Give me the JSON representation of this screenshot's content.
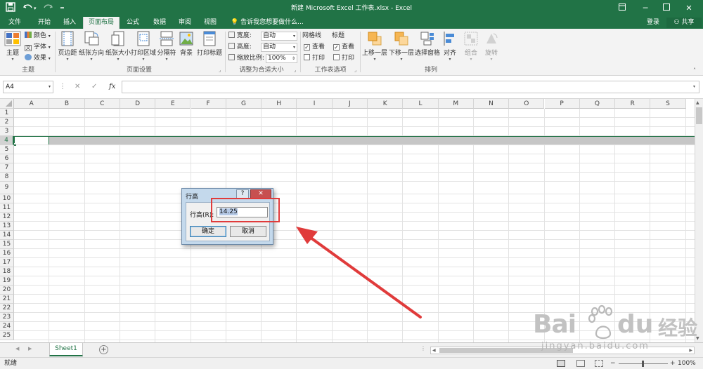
{
  "window": {
    "title": "新建 Microsoft Excel 工作表.xlsx - Excel",
    "qa_save_icon": "save-icon",
    "qa_undo_icon": "undo-icon",
    "qa_redo_icon": "redo-icon",
    "controls": [
      "?",
      "─",
      "□",
      "✕"
    ]
  },
  "tabs": [
    "文件",
    "开始",
    "插入",
    "页面布局",
    "公式",
    "数据",
    "审阅",
    "视图"
  ],
  "active_tab": "页面布局",
  "tell_me": "告诉我您想要做什么...",
  "login": "登录",
  "share": "共享",
  "ribbon": {
    "theme": {
      "main_label": "主题",
      "colors": "颜色",
      "fonts": "字体",
      "effects": "效果",
      "group": "主题"
    },
    "page_setup": {
      "buttons": [
        "页边距",
        "纸张方向",
        "纸张大小",
        "打印区域",
        "分隔符",
        "背景",
        "打印标题"
      ],
      "group": "页面设置"
    },
    "scale": {
      "width_label": "宽度:",
      "width_value": "自动",
      "height_label": "高度:",
      "height_value": "自动",
      "scale_label": "缩放比例:",
      "scale_value": "100%",
      "group": "调整为合适大小"
    },
    "sheet_options": {
      "gridlines": "网格线",
      "headings": "标题",
      "view": "查看",
      "print": "打印",
      "group": "工作表选项"
    },
    "arrange": {
      "buttons": [
        "上移一层",
        "下移一层",
        "选择窗格",
        "对齐",
        "组合",
        "旋转"
      ],
      "group": "排列"
    }
  },
  "formula_bar": {
    "name_box": "A4",
    "cancel": "✕",
    "enter": "✓",
    "fx": "fx"
  },
  "grid": {
    "columns": [
      "A",
      "B",
      "C",
      "D",
      "E",
      "F",
      "G",
      "H",
      "I",
      "J",
      "K",
      "L",
      "M",
      "N",
      "O",
      "P",
      "Q",
      "R",
      "S"
    ],
    "rows": [
      "1",
      "2",
      "3",
      "4",
      "5",
      "6",
      "7",
      "8",
      "9",
      "10",
      "11",
      "12",
      "13",
      "14",
      "15",
      "16",
      "17",
      "18",
      "19",
      "20",
      "21",
      "22",
      "23",
      "24",
      "25"
    ],
    "selected_row": "4"
  },
  "sheet_tab": "Sheet1",
  "add_sheet": "+",
  "status": {
    "ready": "就绪",
    "zoom": "100%"
  },
  "dialog": {
    "title": "行高",
    "help": "?",
    "close": "✕",
    "label": "行高(R):",
    "value": "14.25",
    "ok": "确定",
    "cancel": "取消"
  },
  "watermark": {
    "brand": "Bai",
    "brand2": "du",
    "cn": "经验",
    "url": "jingyan.baidu.com"
  },
  "colors": {
    "excel_green": "#217346",
    "annotation_red": "#e03b3b",
    "dialog_frame": "#c4d9ec"
  }
}
